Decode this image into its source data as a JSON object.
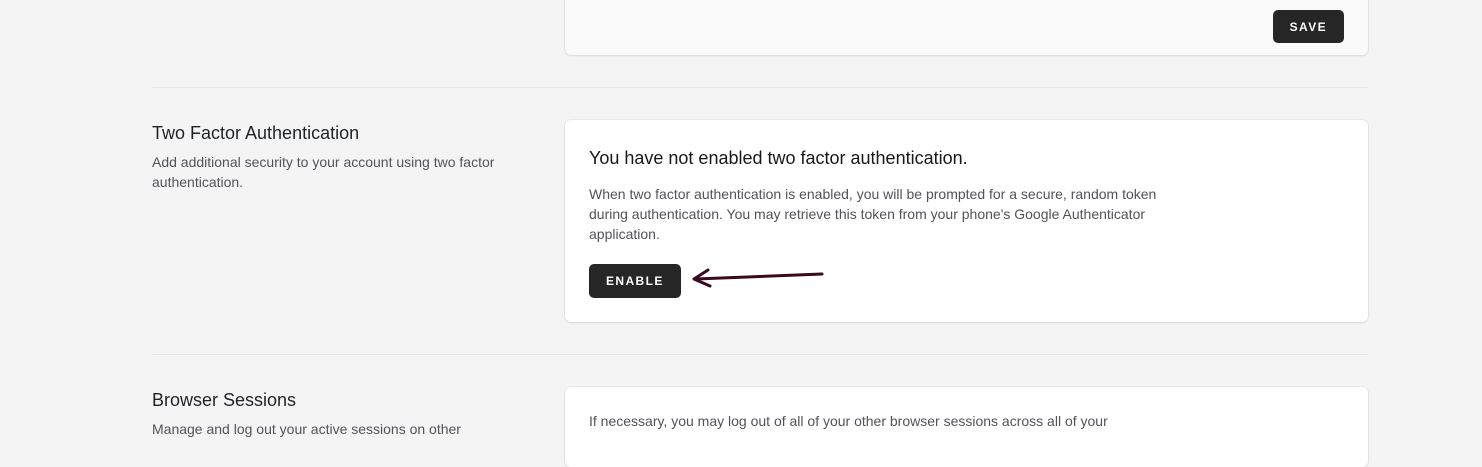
{
  "profile_section": {
    "save_label": "SAVE"
  },
  "two_factor": {
    "title": "Two Factor Authentication",
    "description": "Add additional security to your account using two factor authentication.",
    "status_heading": "You have not enabled two factor authentication.",
    "explanation": "When two factor authentication is enabled, you will be prompted for a secure, random token during authentication. You may retrieve this token from your phone's Google Authenticator application.",
    "enable_label": "ENABLE"
  },
  "browser_sessions": {
    "title": "Browser Sessions",
    "description": "Manage and log out your active sessions on other",
    "explanation": "If necessary, you may log out of all of your other browser sessions across all of your"
  },
  "colors": {
    "background": "#f4f4f5",
    "button": "#262626",
    "arrow_annotation": "#3b0a1f"
  },
  "icons": {
    "annotation": "arrow-left-annotation-icon"
  }
}
